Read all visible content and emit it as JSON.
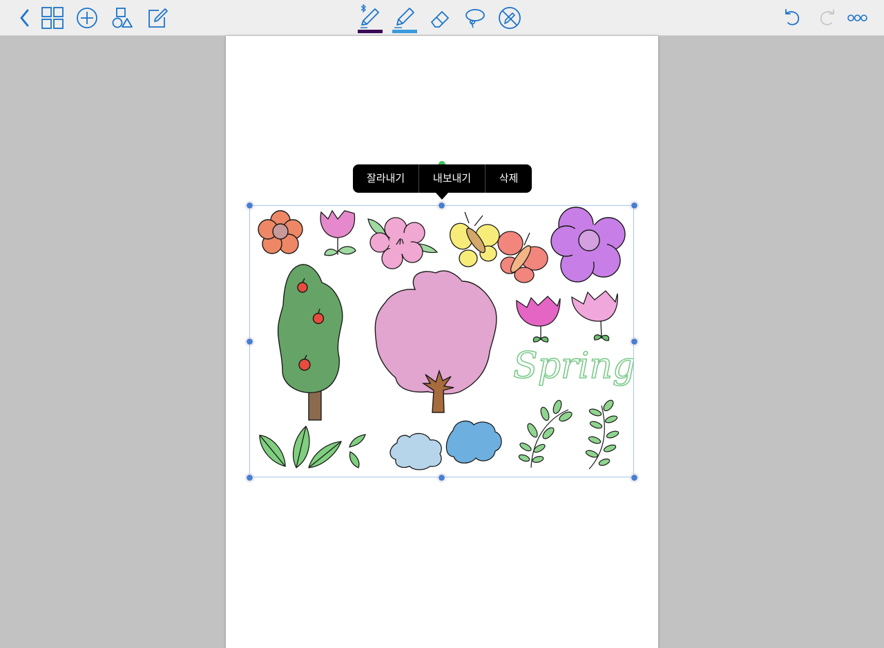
{
  "colors": {
    "accent": "#1a73c9",
    "pen_color": "#3b0a57",
    "highlighter_color": "#3a9bdc",
    "toolbar_bg": "#eeeeee",
    "canvas_bg": "#c2c2c2"
  },
  "toolbar": {
    "left": [
      {
        "name": "back",
        "icon": "chevron-left-icon"
      },
      {
        "name": "thumbnails",
        "icon": "grid-icon"
      },
      {
        "name": "add",
        "icon": "plus-circle-icon"
      },
      {
        "name": "shapes",
        "icon": "shapes-icon"
      },
      {
        "name": "edit",
        "icon": "edit-icon"
      }
    ],
    "tools": [
      {
        "name": "pen",
        "icon": "bluetooth-pen-icon",
        "selected": true
      },
      {
        "name": "highlighter",
        "icon": "highlighter-icon",
        "selected": false
      },
      {
        "name": "eraser",
        "icon": "eraser-icon",
        "selected": false
      },
      {
        "name": "lasso",
        "icon": "lasso-icon",
        "selected": false
      },
      {
        "name": "disable-pen",
        "icon": "pen-off-icon",
        "selected": false
      }
    ],
    "right": [
      {
        "name": "undo",
        "icon": "undo-icon",
        "enabled": true
      },
      {
        "name": "redo",
        "icon": "redo-icon",
        "enabled": false
      },
      {
        "name": "more",
        "icon": "more-icon",
        "enabled": true
      }
    ]
  },
  "context_menu": {
    "items": [
      "잘라내기",
      "내보내기",
      "삭제"
    ]
  },
  "selection": {
    "artwork_text": "Spring"
  }
}
